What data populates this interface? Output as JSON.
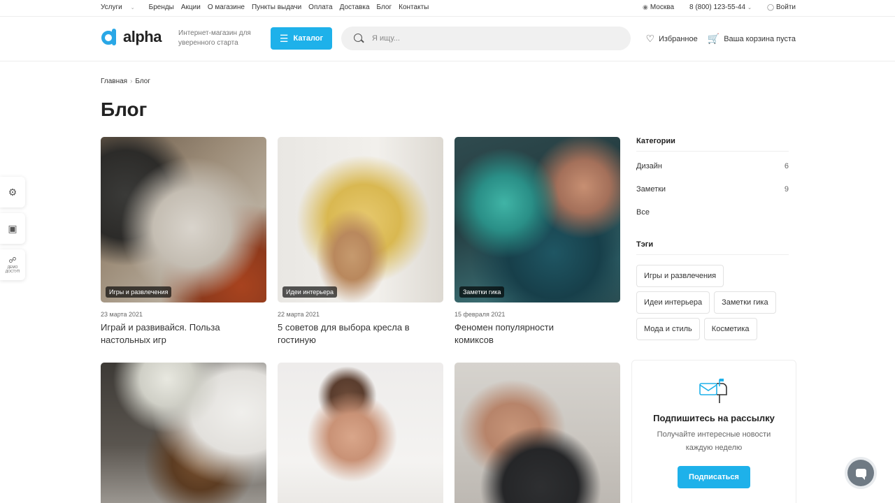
{
  "topnav": {
    "items": [
      "Услуги",
      "Бренды",
      "Акции",
      "О магазине",
      "Пункты выдачи",
      "Оплата",
      "Доставка",
      "Блог",
      "Контакты"
    ],
    "city": "Москва",
    "phone": "8 (800) 123-55-44",
    "login": "Войти"
  },
  "header": {
    "logo_text": "alpha",
    "tagline": "Интернет-магазин для уверенного старта",
    "catalog_label": "Каталог",
    "search_placeholder": "Я ищу...",
    "favorites_label": "Избранное",
    "cart_label": "Ваша корзина пуста",
    "accent_color": "#1eb1ea"
  },
  "sidetools": {
    "demo_label": "ДЕМО ДОСТУП"
  },
  "breadcrumb": [
    "Главная",
    "Блог"
  ],
  "page_title": "Блог",
  "posts": [
    {
      "tag": "Игры и развлечения",
      "date": "23 марта 2021",
      "title": "Играй и развивайся. Польза настольных игр"
    },
    {
      "tag": "Идеи интерьера",
      "date": "22 марта 2021",
      "title": "5 советов для выбора кресла в гостиную"
    },
    {
      "tag": "Заметки гика",
      "date": "15 февраля 2021",
      "title": "Феномен популярности комиксов"
    },
    {
      "tag": "",
      "date": "",
      "title": ""
    },
    {
      "tag": "",
      "date": "",
      "title": ""
    },
    {
      "tag": "",
      "date": "",
      "title": ""
    }
  ],
  "sidebar": {
    "categories_title": "Категории",
    "categories": [
      {
        "label": "Дизайн",
        "count": "6"
      },
      {
        "label": "Заметки",
        "count": "9"
      },
      {
        "label": "Все",
        "count": ""
      }
    ],
    "tags_title": "Тэги",
    "tags": [
      "Игры и развлечения",
      "Идеи интерьера",
      "Заметки гика",
      "Мода и стиль",
      "Косметика"
    ]
  },
  "subscribe": {
    "title": "Подпишитесь на рассылку",
    "text": "Получайте интересные новости каждую неделю",
    "button": "Подписаться"
  }
}
